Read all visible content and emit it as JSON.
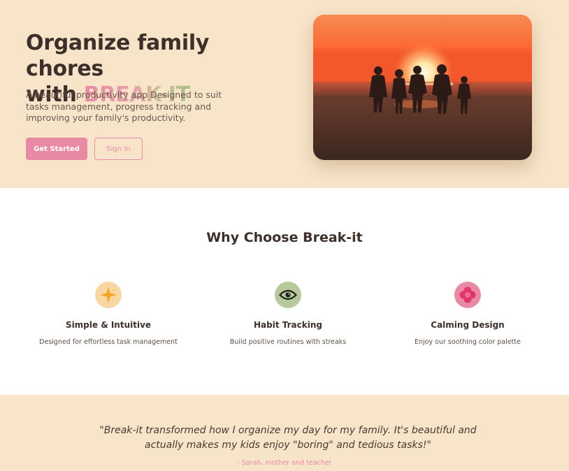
{
  "hero": {
    "title_line1": "Organize family chores",
    "title_with": "with ",
    "brand": "BREAK-IT",
    "description": "A beautiful productivity app Designed to suit tasks management, progress tracking and improving your family's productivity.",
    "cta_primary": "Get Started",
    "cta_secondary": "Sign In",
    "photo": "family-sunset-beach-photo"
  },
  "features": {
    "title": "Why Choose Break-it",
    "items": [
      {
        "icon": "sparkle-icon",
        "title": "Simple & Intuitive",
        "description": "Designed for effortless task management",
        "icon_bg": "#f8d7a5"
      },
      {
        "icon": "eye-icon",
        "title": "Habit Tracking",
        "description": "Build positive routines with streaks",
        "icon_bg": "#b7c99c"
      },
      {
        "icon": "flower-icon",
        "title": "Calming Design",
        "description": "Enjoy our soothing color palette",
        "icon_bg": "#e98aa5"
      }
    ]
  },
  "testimonial": {
    "quote": "\"Break-it transformed how I organize my day for my family. It's beautiful and actually makes my kids enjoy \"boring\" and tedious tasks!\"",
    "author": "- Sarah, mother and teacher"
  },
  "colors": {
    "accent_pink": "#e98aa5",
    "cream_bg": "#f8e4c8",
    "text_dark": "#3d302b"
  }
}
